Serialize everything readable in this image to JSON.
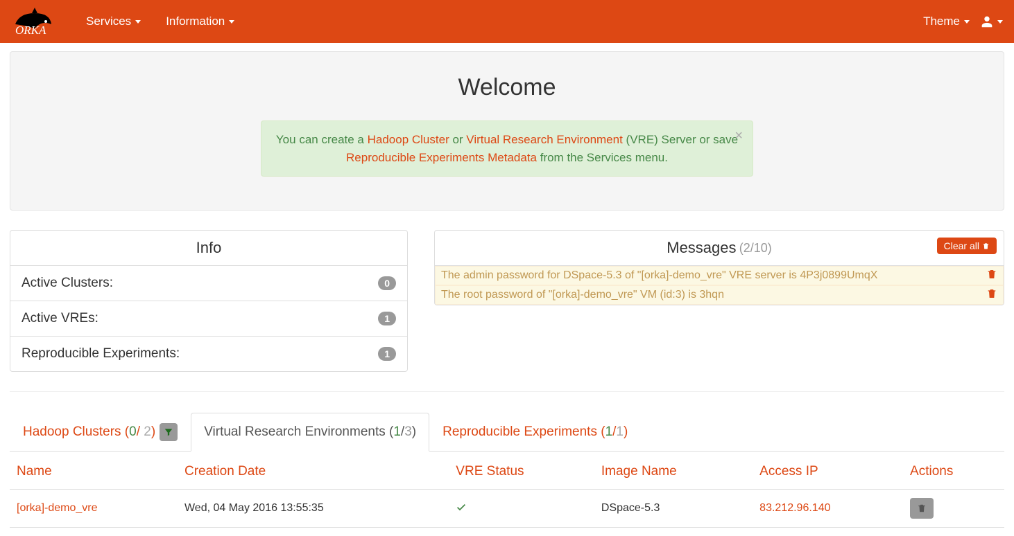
{
  "navbar": {
    "brand": "ORKA",
    "services": "Services",
    "information": "Information",
    "theme": "Theme"
  },
  "jumbo": {
    "title": "Welcome",
    "alert": {
      "pre1": "You can create a ",
      "link1": "Hadoop Cluster",
      "mid1": " or ",
      "link2": "Virtual Research Environment",
      "post1": " (VRE) Server or save ",
      "link3": "Reproducible Experiments Metadata",
      "post2": " from the Services menu."
    }
  },
  "info": {
    "heading": "Info",
    "items": [
      {
        "label": "Active Clusters:",
        "count": "0"
      },
      {
        "label": "Active VREs:",
        "count": "1"
      },
      {
        "label": "Reproducible Experiments:",
        "count": "1"
      }
    ]
  },
  "messages": {
    "heading": "Messages",
    "count": "(2/10)",
    "clear": "Clear all",
    "items": [
      "The admin password for DSpace-5.3 of \"[orka]-demo_vre\" VRE server is 4P3j0899UmqX",
      "The root password of \"[orka]-demo_vre\" VM (id:3) is 3hqn"
    ]
  },
  "tabs": {
    "hadoop": {
      "label": "Hadoop Clusters",
      "active": "0",
      "total": "2"
    },
    "vre": {
      "label": "Virtual Research Environments",
      "active": "1",
      "total": "3"
    },
    "repro": {
      "label": "Reproducible Experiments",
      "active": "1",
      "total": "1"
    }
  },
  "table": {
    "headers": {
      "name": "Name",
      "date": "Creation Date",
      "status": "VRE Status",
      "image": "Image Name",
      "ip": "Access IP",
      "actions": "Actions"
    },
    "rows": [
      {
        "name": "[orka]-demo_vre",
        "date": "Wed, 04 May 2016 13:55:35",
        "image": "DSpace-5.3",
        "ip": "83.212.96.140"
      }
    ]
  }
}
